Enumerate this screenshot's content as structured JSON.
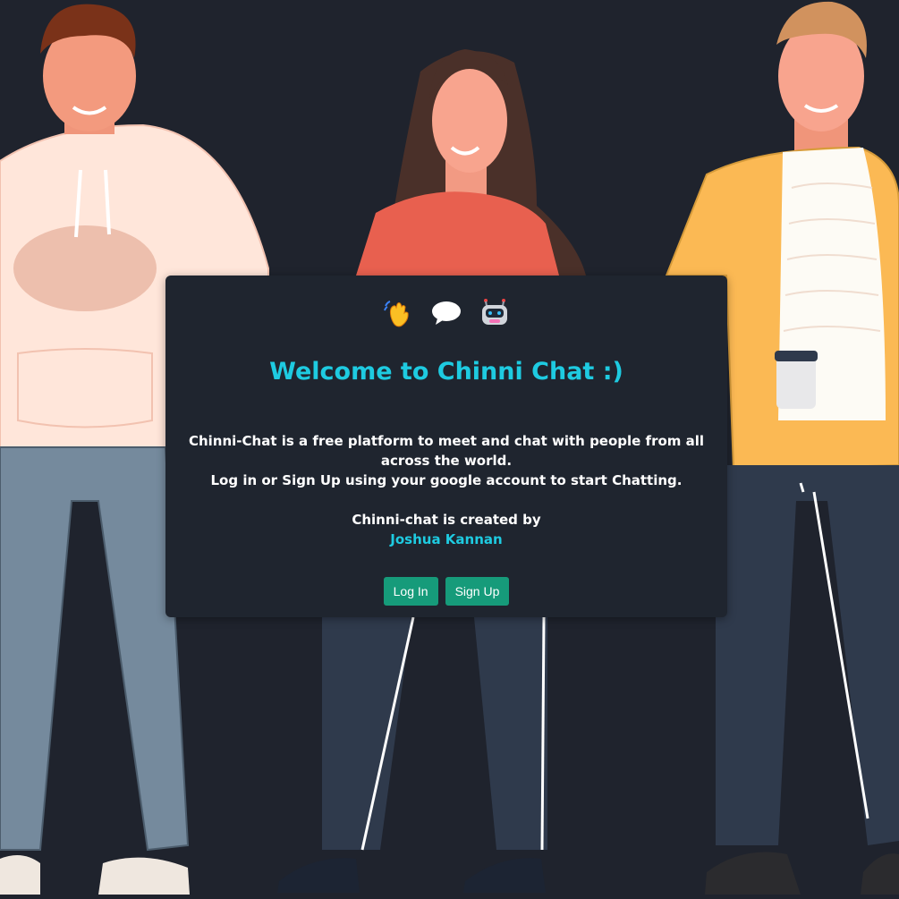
{
  "emojis": [
    "waving-hand",
    "speech-bubble",
    "robot-face"
  ],
  "welcome": {
    "title": "Welcome to Chinni Chat :)",
    "description_line1": "Chinni-Chat is a free platform to meet and chat with people from all across the world.",
    "description_line2": "Log in or Sign Up using your google account to start Chatting.",
    "created_by_label": "Chinni-chat is created by",
    "author": "Joshua Kannan"
  },
  "buttons": {
    "login": "Log In",
    "signup": "Sign Up"
  },
  "colors": {
    "background": "#1f232d",
    "card": "#1f252f",
    "accent": "#1ecbe1",
    "button": "#169b7a"
  }
}
